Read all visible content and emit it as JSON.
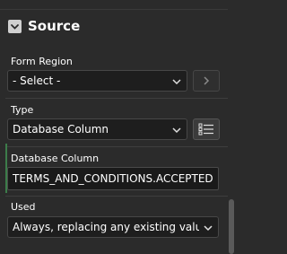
{
  "section": {
    "title": "Source",
    "icon": "chevron-down-icon"
  },
  "form_region": {
    "label": "Form Region",
    "value": "- Select -",
    "go_icon": "chevron-right-icon"
  },
  "type": {
    "label": "Type",
    "value": "Database Column",
    "list_icon": "list-icon"
  },
  "database_column": {
    "label": "Database Column",
    "value": "TERMS_AND_CONDITIONS.ACCEPTED"
  },
  "used": {
    "label": "Used",
    "value": "Always, replacing any existing value in session state"
  },
  "colors": {
    "background": "#2b2b2b",
    "field": "#1e1e1e",
    "accent": "#3c7d4a"
  }
}
